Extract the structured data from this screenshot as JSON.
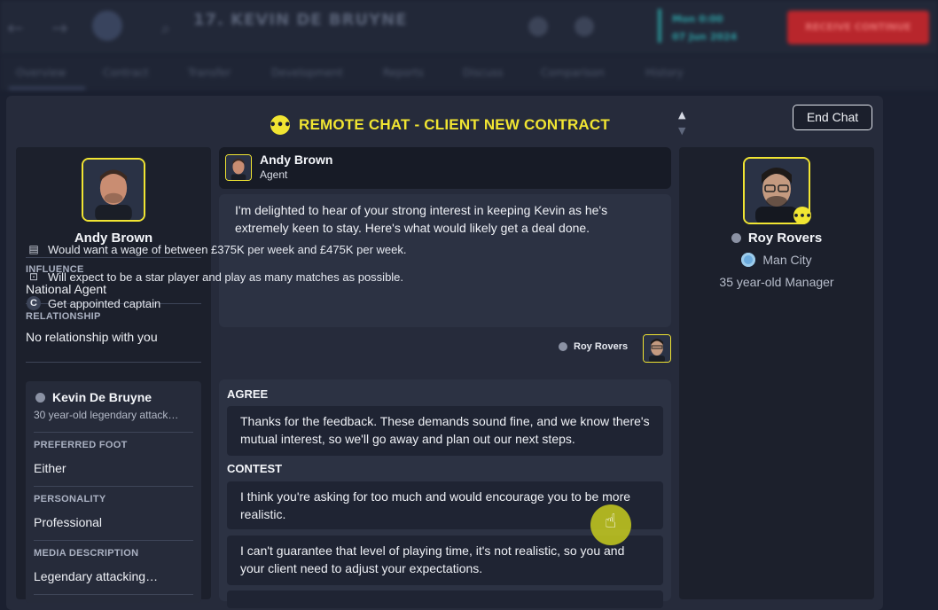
{
  "background": {
    "player_title": "17. KEVIN DE BRUYNE",
    "player_sub": "",
    "date_line1": "Mon 0:00",
    "date_line2": "07 Jun 2024",
    "continue_label": "RECEIVE CONTINUE",
    "tabs": [
      "Overview",
      "Contract",
      "Transfer",
      "Development",
      "Reports",
      "Discuss",
      "Comparison",
      "History"
    ]
  },
  "modal": {
    "title": "REMOTE CHAT - CLIENT NEW CONTRACT",
    "end_chat_label": "End Chat"
  },
  "left": {
    "agent_name": "Andy Brown",
    "influence_label": "INFLUENCE",
    "influence_value": "National Agent",
    "relationship_label": "RELATIONSHIP",
    "relationship_value": "No relationship with you",
    "player": {
      "name": "Kevin De Bruyne",
      "desc": "30 year-old legendary attack…",
      "preferred_foot_label": "PREFERRED FOOT",
      "preferred_foot_value": "Either",
      "personality_label": "PERSONALITY",
      "personality_value": "Professional",
      "media_label": "MEDIA DESCRIPTION",
      "media_value": "Legendary attacking…"
    }
  },
  "chat": {
    "header_name": "Andy Brown",
    "header_role": "Agent",
    "message": "I'm delighted to hear of your strong interest in keeping Kevin as he's extremely keen to stay. Here's what would likely get a deal done.",
    "requests": [
      {
        "icon": "contract-icon",
        "text": "Would want a wage of between £375K per week and £475K per week."
      },
      {
        "icon": "playing-time-icon",
        "text": "Will expect to be a star player and play as many matches as possible."
      },
      {
        "icon": "captain-icon",
        "text": "Get appointed captain"
      }
    ],
    "reply_name": "Roy Rovers",
    "agree_label": "AGREE",
    "agree_options": [
      "Thanks for the feedback. These demands sound fine, and we know there's mutual interest, so we'll go away and plan out our next steps."
    ],
    "contest_label": "CONTEST",
    "contest_options": [
      "I think you're asking for too much and would encourage you to be more realistic.",
      "I can't guarantee that level of playing time, it's not realistic, so you and your client need to adjust your expectations."
    ]
  },
  "right": {
    "name": "Roy Rovers",
    "club": "Man City",
    "desc": "35 year-old Manager"
  },
  "colors": {
    "accent_yellow": "#f1e532",
    "modal_bg": "#262b3b",
    "panel_bg": "#1c202c",
    "option_bg": "#1f2433",
    "club_blue": "#6cabdd"
  }
}
